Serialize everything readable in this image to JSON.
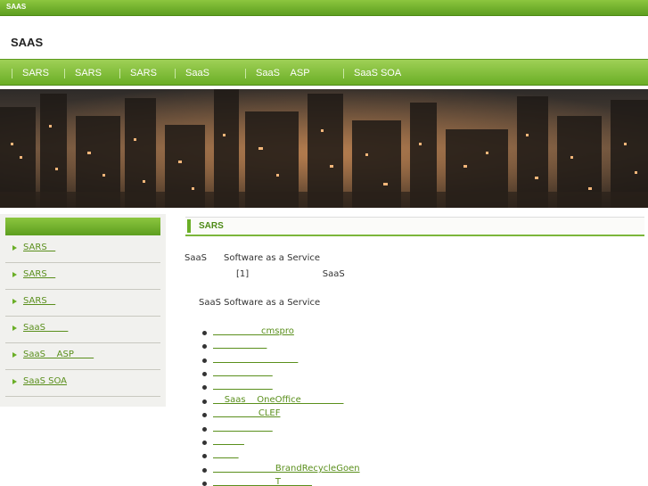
{
  "topbar": {
    "label": "SAAS"
  },
  "header": {
    "title": "SAAS"
  },
  "nav": {
    "items": [
      {
        "label": "SARS"
      },
      {
        "label": "SARS"
      },
      {
        "label": "SARS"
      },
      {
        "label": "SaaS"
      },
      {
        "label": "SaaS    ASP"
      },
      {
        "label": "SaaS SOA"
      }
    ]
  },
  "sidebar": {
    "items": [
      {
        "label": "SARS   "
      },
      {
        "label": "SARS   "
      },
      {
        "label": "SARS   "
      },
      {
        "label": "SaaS        "
      },
      {
        "label": "SaaS    ASP       "
      },
      {
        "label": "SaaS SOA"
      }
    ]
  },
  "main": {
    "section_title": "SARS",
    "intro_line1": "SaaS      Software as a Service",
    "intro_line2": "[1]                          SaaS",
    "intro_line3": "SaaS Software as a Service",
    "links": [
      "                 cmspro",
      "                   ",
      "                              ",
      "                     ",
      "                     ",
      "    Saas    OneOffice               ",
      "                CLEF",
      "                     ",
      "           ",
      "         ",
      "                      BrandRecycleGoen",
      "                      T           "
    ]
  }
}
